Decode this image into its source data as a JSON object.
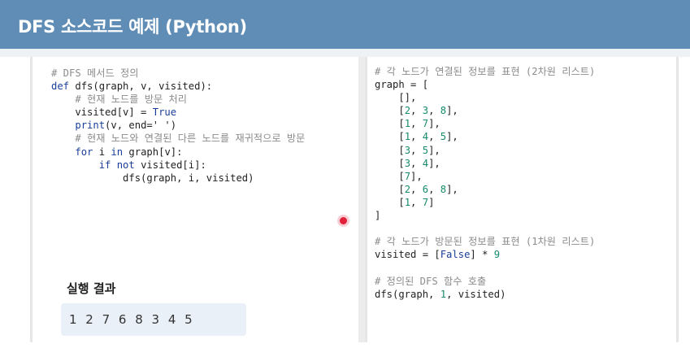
{
  "header": {
    "title": "DFS 소스코드 예제 (Python)"
  },
  "left_code": {
    "lines": [
      {
        "segments": [
          {
            "t": "# DFS 메서드 정의",
            "c": "cm"
          }
        ]
      },
      {
        "segments": [
          {
            "t": "def",
            "c": "kw"
          },
          {
            "t": " dfs(graph, v, visited):",
            "c": ""
          }
        ]
      },
      {
        "segments": [
          {
            "t": "    ",
            "c": ""
          },
          {
            "t": "# 현재 노드를 방문 처리",
            "c": "cm"
          }
        ]
      },
      {
        "segments": [
          {
            "t": "    visited[v] = ",
            "c": ""
          },
          {
            "t": "True",
            "c": "kw"
          }
        ]
      },
      {
        "segments": [
          {
            "t": "    ",
            "c": ""
          },
          {
            "t": "print",
            "c": "kw"
          },
          {
            "t": "(v, end=' ')",
            "c": ""
          }
        ]
      },
      {
        "segments": [
          {
            "t": "    ",
            "c": ""
          },
          {
            "t": "# 현재 노드와 연결된 다른 노드를 재귀적으로 방문",
            "c": "cm"
          }
        ]
      },
      {
        "segments": [
          {
            "t": "    ",
            "c": ""
          },
          {
            "t": "for",
            "c": "kw"
          },
          {
            "t": " i ",
            "c": ""
          },
          {
            "t": "in",
            "c": "kw"
          },
          {
            "t": " graph[v]:",
            "c": ""
          }
        ]
      },
      {
        "segments": [
          {
            "t": "        ",
            "c": ""
          },
          {
            "t": "if not",
            "c": "kw"
          },
          {
            "t": " visited[i]:",
            "c": ""
          }
        ]
      },
      {
        "segments": [
          {
            "t": "            dfs(graph, i, visited)",
            "c": ""
          }
        ]
      }
    ]
  },
  "right_code": {
    "lines": [
      {
        "segments": [
          {
            "t": "# 각 노드가 연결된 정보를 표현 (2차원 리스트)",
            "c": "cm"
          }
        ]
      },
      {
        "segments": [
          {
            "t": "graph = [",
            "c": ""
          }
        ]
      },
      {
        "segments": [
          {
            "t": "    [],",
            "c": ""
          }
        ]
      },
      {
        "segments": [
          {
            "t": "    [",
            "c": ""
          },
          {
            "t": "2",
            "c": "nm"
          },
          {
            "t": ", ",
            "c": ""
          },
          {
            "t": "3",
            "c": "nm"
          },
          {
            "t": ", ",
            "c": ""
          },
          {
            "t": "8",
            "c": "nm"
          },
          {
            "t": "],",
            "c": ""
          }
        ]
      },
      {
        "segments": [
          {
            "t": "    [",
            "c": ""
          },
          {
            "t": "1",
            "c": "nm"
          },
          {
            "t": ", ",
            "c": ""
          },
          {
            "t": "7",
            "c": "nm"
          },
          {
            "t": "],",
            "c": ""
          }
        ]
      },
      {
        "segments": [
          {
            "t": "    [",
            "c": ""
          },
          {
            "t": "1",
            "c": "nm"
          },
          {
            "t": ", ",
            "c": ""
          },
          {
            "t": "4",
            "c": "nm"
          },
          {
            "t": ", ",
            "c": ""
          },
          {
            "t": "5",
            "c": "nm"
          },
          {
            "t": "],",
            "c": ""
          }
        ]
      },
      {
        "segments": [
          {
            "t": "    [",
            "c": ""
          },
          {
            "t": "3",
            "c": "nm"
          },
          {
            "t": ", ",
            "c": ""
          },
          {
            "t": "5",
            "c": "nm"
          },
          {
            "t": "],",
            "c": ""
          }
        ]
      },
      {
        "segments": [
          {
            "t": "    [",
            "c": ""
          },
          {
            "t": "3",
            "c": "nm"
          },
          {
            "t": ", ",
            "c": ""
          },
          {
            "t": "4",
            "c": "nm"
          },
          {
            "t": "],",
            "c": ""
          }
        ]
      },
      {
        "segments": [
          {
            "t": "    [",
            "c": ""
          },
          {
            "t": "7",
            "c": "nm"
          },
          {
            "t": "],",
            "c": ""
          }
        ]
      },
      {
        "segments": [
          {
            "t": "    [",
            "c": ""
          },
          {
            "t": "2",
            "c": "nm"
          },
          {
            "t": ", ",
            "c": ""
          },
          {
            "t": "6",
            "c": "nm"
          },
          {
            "t": ", ",
            "c": ""
          },
          {
            "t": "8",
            "c": "nm"
          },
          {
            "t": "],",
            "c": ""
          }
        ]
      },
      {
        "segments": [
          {
            "t": "    [",
            "c": ""
          },
          {
            "t": "1",
            "c": "nm"
          },
          {
            "t": ", ",
            "c": ""
          },
          {
            "t": "7",
            "c": "nm"
          },
          {
            "t": "]",
            "c": ""
          }
        ]
      },
      {
        "segments": [
          {
            "t": "]",
            "c": ""
          }
        ]
      },
      {
        "segments": [
          {
            "t": "",
            "c": ""
          }
        ]
      },
      {
        "segments": [
          {
            "t": "# 각 노드가 방문된 정보를 표현 (1차원 리스트)",
            "c": "cm"
          }
        ]
      },
      {
        "segments": [
          {
            "t": "visited = [",
            "c": ""
          },
          {
            "t": "False",
            "c": "kw"
          },
          {
            "t": "] * ",
            "c": ""
          },
          {
            "t": "9",
            "c": "nm"
          }
        ]
      },
      {
        "segments": [
          {
            "t": "",
            "c": ""
          }
        ]
      },
      {
        "segments": [
          {
            "t": "# 정의된 DFS 함수 호출",
            "c": "cm"
          }
        ]
      },
      {
        "segments": [
          {
            "t": "dfs(graph, ",
            "c": ""
          },
          {
            "t": "1",
            "c": "nm"
          },
          {
            "t": ", visited)",
            "c": ""
          }
        ]
      }
    ]
  },
  "result": {
    "title": "실행 결과",
    "value": "1 2 7 6 8 3 4 5"
  },
  "colors": {
    "header_bg": "#5f8db5",
    "keyword": "#1a3e9a",
    "number": "#178a6b",
    "comment": "#8c8c8c",
    "result_box": "#e9f0f7",
    "pointer": "#e2223a"
  }
}
